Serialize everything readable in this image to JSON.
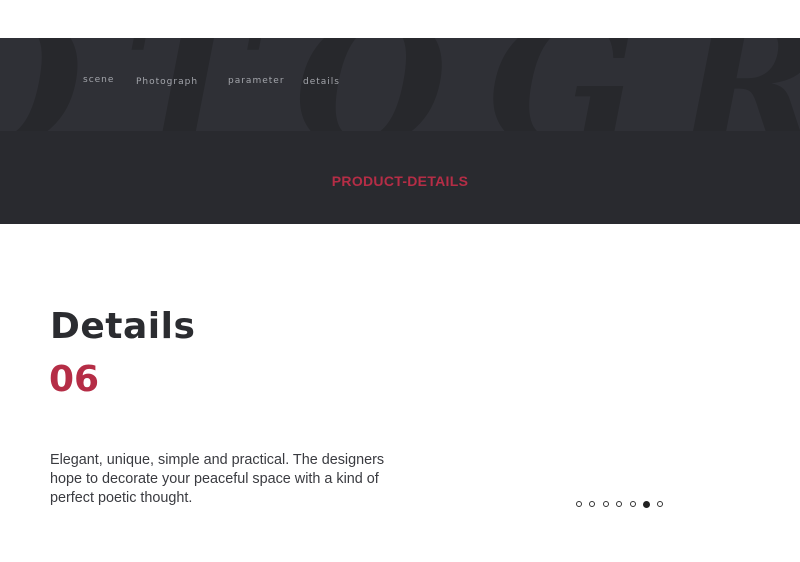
{
  "nav": {
    "items": [
      {
        "label": "scene"
      },
      {
        "label": "Photograph"
      },
      {
        "label": "parameter"
      },
      {
        "label": "details"
      }
    ]
  },
  "banner": {
    "title": "PRODUCT-DETAILS",
    "watermark_text": "OTOGRA"
  },
  "section": {
    "heading": "Details",
    "number": "06",
    "description": "Elegant, unique, simple and practical. The designers hope to decorate your peaceful space with a kind of perfect poetic thought."
  },
  "pagination": {
    "total": 7,
    "active_index": 6
  },
  "colors": {
    "accent": "#b52d46",
    "banner_dark": "#292a2f",
    "banner_top": "#2f3036",
    "heading": "#2b2c30"
  }
}
